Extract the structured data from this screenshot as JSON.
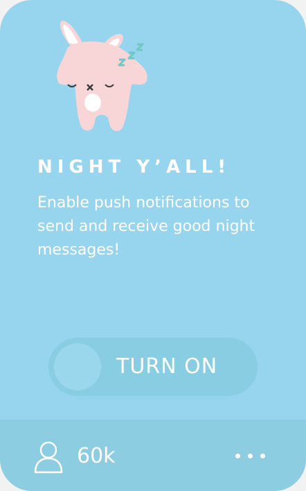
{
  "card": {
    "title": "NIGHT Y’ALL!",
    "message": "Enable push notifications to send and receive good night messages!",
    "mascot_icon": "sleeping-bunny-icon"
  },
  "toggle": {
    "label": "TURN ON",
    "state": "off"
  },
  "footer": {
    "user_icon": "user-icon",
    "count": "60k",
    "more_icon": "more-dots-icon"
  },
  "colors": {
    "card_background": "#97d5ee",
    "footer_background": "#8ccde1",
    "toggle_track": "#89cde3",
    "text": "#ffffff",
    "bunny": "#f8d6d8",
    "zzz": "#6fc7c7"
  }
}
